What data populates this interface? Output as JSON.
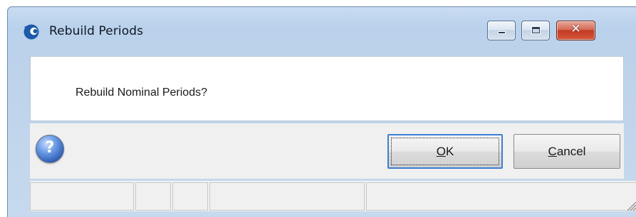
{
  "window": {
    "title": "Rebuild Periods",
    "icon": "app-logo-icon",
    "controls": {
      "minimize": "minimize-icon",
      "maximize": "maximize-icon",
      "close": "close-icon",
      "close_glyph": "✕"
    }
  },
  "dialog": {
    "message": "Rebuild Nominal Periods?",
    "help_icon": "help-icon",
    "help_glyph": "?",
    "ok": {
      "mnemonic": "O",
      "rest": "K"
    },
    "cancel": {
      "mnemonic": "C",
      "rest": "ancel"
    }
  },
  "statusbar": {
    "panels": [
      "",
      "",
      "",
      "",
      ""
    ],
    "grip_icon": "resize-grip-icon"
  },
  "colors": {
    "focus_border": "#3c7fd0",
    "close_button": "#c23a22",
    "help_blue": "#2f5fb8"
  }
}
